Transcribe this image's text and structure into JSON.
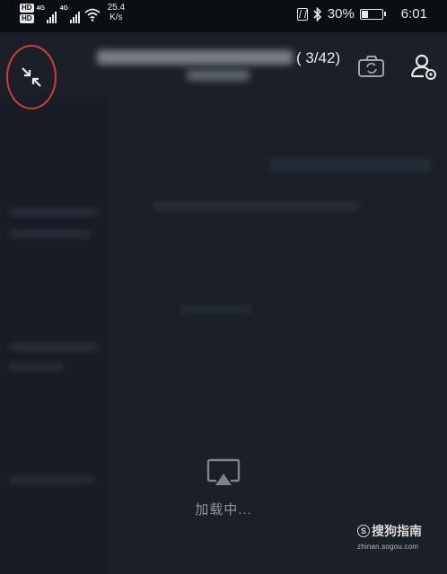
{
  "status_bar": {
    "hd1": "HD",
    "hd2": "HD",
    "net1": "4G",
    "net2": "4G",
    "speed_value": "25.4",
    "speed_unit": "K/s",
    "battery": "30%",
    "time": "6:01"
  },
  "header": {
    "page_counter": "( 3/42)"
  },
  "loading": {
    "text": "加载中..."
  },
  "watermark": {
    "brand": "搜狗指南",
    "url": "zhinan.sogou.com"
  }
}
